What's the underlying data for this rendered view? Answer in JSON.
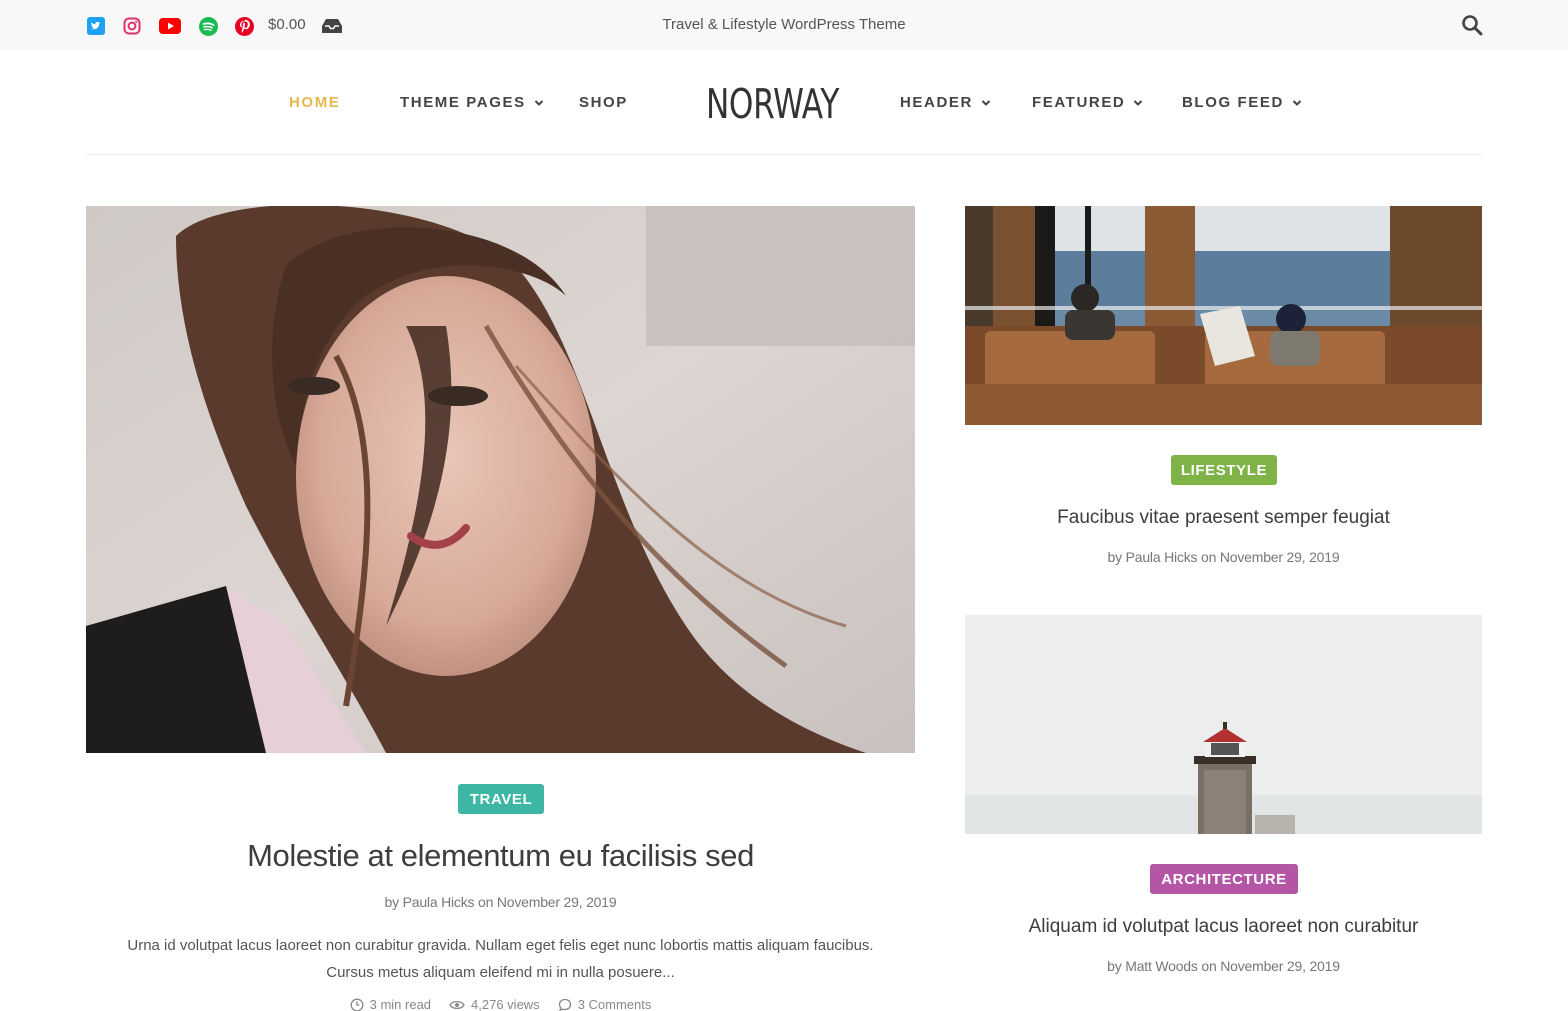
{
  "topbar": {
    "social": [
      {
        "icon": "twitter-icon",
        "color": "#1da1f2"
      },
      {
        "icon": "instagram-icon",
        "color": "#e1306c"
      },
      {
        "icon": "youtube-icon",
        "color": "#ff0000"
      },
      {
        "icon": "spotify-icon",
        "color": "#1db954"
      },
      {
        "icon": "pinterest-icon",
        "color": "#e60023"
      }
    ],
    "cart_total": "$0.00",
    "tagline": "Travel & Lifestyle WordPress Theme"
  },
  "nav": {
    "logo": "NORWAY",
    "items": [
      {
        "label": "HOME",
        "active": true
      },
      {
        "label": "THEME PAGES",
        "dropdown": true
      },
      {
        "label": "SHOP"
      },
      {
        "label": "HEADER",
        "dropdown": true
      },
      {
        "label": "FEATURED",
        "dropdown": true
      },
      {
        "label": "BLOG FEED",
        "dropdown": true
      }
    ],
    "active_color": "#e8b84e"
  },
  "main_post": {
    "category": "TRAVEL",
    "category_color": "#3db7a3",
    "title": "Molestie at elementum eu facilisis sed",
    "byline": "by Paula Hicks on November 29, 2019",
    "excerpt_line1": "Urna id volutpat lacus laoreet non curabitur gravida. Nullam eget felis eget nunc lobortis mattis aliquam faucibus.",
    "excerpt_line2": "Cursus metus aliquam eleifend mi in nulla posuere...",
    "read_time": "3 min read",
    "views": "4,276 views",
    "comments": "3 Comments"
  },
  "side_posts": [
    {
      "category": "LIFESTYLE",
      "category_color": "#7fb347",
      "title": "Faucibus vitae praesent semper feugiat",
      "byline": "by Paula Hicks on November 29, 2019"
    },
    {
      "category": "ARCHITECTURE",
      "category_color": "#b456a5",
      "title": "Aliquam id volutpat lacus laoreet non curabitur",
      "byline": "by Matt Woods on November 29, 2019"
    }
  ]
}
